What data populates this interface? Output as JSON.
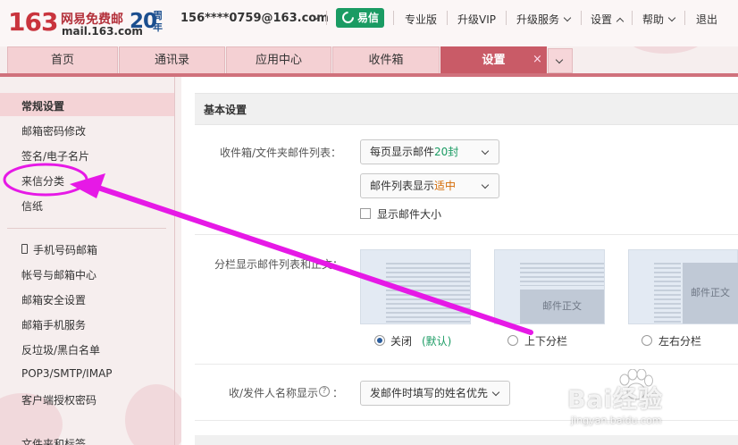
{
  "logo": {
    "number": "163",
    "cn_text": "网易免费邮",
    "domain": "mail.163.com",
    "anniv_num": "20",
    "anniv_text": "周年"
  },
  "topbar": {
    "account": "156****0759@163.com",
    "yixin_label": "易信",
    "links": [
      "专业版",
      "升级VIP",
      "升级服务",
      "设置",
      "帮助",
      "退出"
    ]
  },
  "tabs": [
    {
      "label": "首页",
      "active": false
    },
    {
      "label": "通讯录",
      "active": false
    },
    {
      "label": "应用中心",
      "active": false
    },
    {
      "label": "收件箱",
      "active": false
    },
    {
      "label": "设置",
      "active": true
    }
  ],
  "tab_close": "×",
  "sidebar": {
    "items": [
      {
        "label": "常规设置",
        "active": true
      },
      {
        "label": "邮箱密码修改"
      },
      {
        "label": "签名/电子名片"
      },
      {
        "label": "来信分类",
        "highlighted": true
      },
      {
        "label": "信纸"
      },
      {
        "label": "手机号码邮箱"
      },
      {
        "label": "帐号与邮箱中心"
      },
      {
        "label": "邮箱安全设置"
      },
      {
        "label": "邮箱手机服务"
      },
      {
        "label": "反垃圾/黑白名单"
      },
      {
        "label": "POP3/SMTP/IMAP"
      },
      {
        "label": "客户端授权密码"
      },
      {
        "label": "文件夹和标签"
      }
    ]
  },
  "main": {
    "section_title": "基本设置",
    "inbox_list": {
      "label": "收件箱/文件夹邮件列表：",
      "per_page_prefix": "每页显示邮件",
      "per_page_value": "20封",
      "display_prefix": "邮件列表显示",
      "display_value": "适中",
      "show_size_label": "显示邮件大小",
      "show_size_checked": false
    },
    "split_view": {
      "label": "分栏显示邮件列表和正文：",
      "pane_text": "邮件正文",
      "options": [
        {
          "label": "关闭",
          "note": "(默认)",
          "selected": true
        },
        {
          "label": "上下分栏",
          "selected": false
        },
        {
          "label": "左右分栏",
          "selected": false
        }
      ]
    },
    "sender_name": {
      "label": "收/发件人名称显示",
      "help": "?",
      "colon": "：",
      "value": "发邮件时填写的姓名优先"
    }
  },
  "watermark": {
    "text": "Bai经验",
    "sub": "jingyan.baidu.com"
  },
  "colors": {
    "brand_red": "#c9343d",
    "tab_active": "#c95b67",
    "tab_inactive": "#f4d0d3",
    "yixin_green": "#1a9b63",
    "annotation_magenta": "#e619e6",
    "highlight_green": "#1a9b63",
    "highlight_orange": "#d36800"
  }
}
